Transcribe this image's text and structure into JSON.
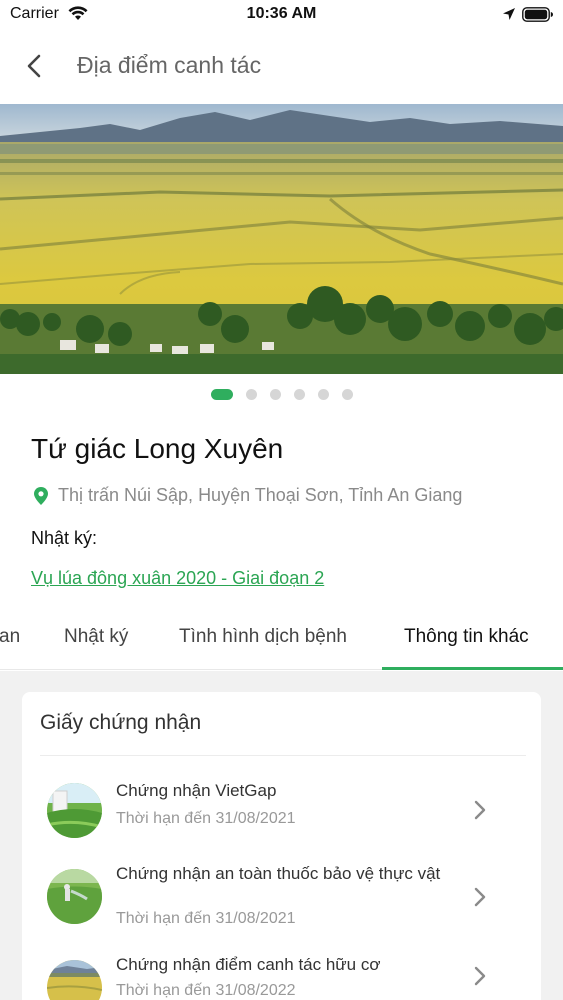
{
  "status_bar": {
    "carrier": "Carrier",
    "time": "10:36 AM"
  },
  "nav": {
    "title": "Địa điểm canh tác",
    "back_icon": "chevron-left-icon"
  },
  "gallery": {
    "image_count": 6,
    "active_index": 0
  },
  "place": {
    "name": "Tứ giác Long Xuyên",
    "address": "Thị trấn Núi Sập, Huyện Thoại Sơn, Tỉnh An Giang",
    "diary_label": "Nhật ký:",
    "diary_link": "Vụ lúa đông xuân 2020 - Giai đoạn 2"
  },
  "tabs": {
    "items": [
      {
        "label": "an"
      },
      {
        "label": "Nhật ký"
      },
      {
        "label": "Tình hình dịch bệnh"
      },
      {
        "label": "Thông tin khác"
      }
    ],
    "active": "Thông tin khác"
  },
  "certificates": {
    "title": "Giấy chứng nhận",
    "items": [
      {
        "name": "Chứng nhận VietGap",
        "expiry": "Thời hạn đến 31/08/2021"
      },
      {
        "name": "Chứng nhận an toàn thuốc bảo vệ thực vật",
        "expiry": "Thời hạn đến 31/08/2021"
      },
      {
        "name": "Chứng nhận điểm canh tác hữu cơ",
        "expiry": "Thời hạn đến 31/08/2022"
      }
    ]
  },
  "colors": {
    "accent": "#2fae5e",
    "link": "#2ba553",
    "background": "#f1f1f1"
  }
}
